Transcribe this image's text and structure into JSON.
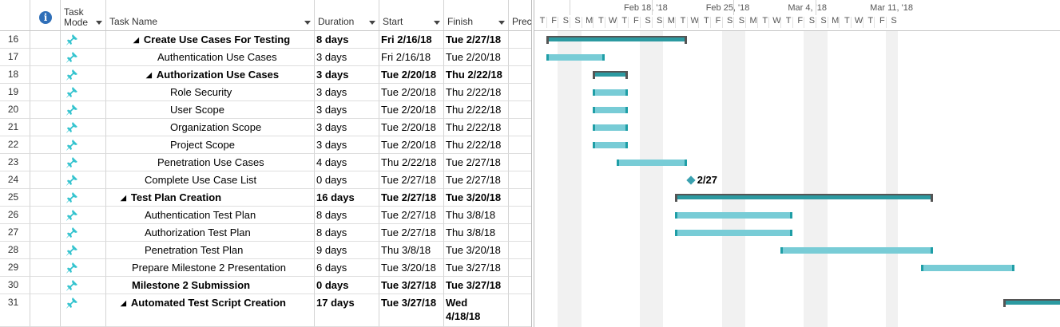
{
  "columns": {
    "info": "i",
    "mode": "Task Mode",
    "mode_line1": "Task",
    "mode_line2": "Mode",
    "name": "Task Name",
    "duration": "Duration",
    "start": "Start",
    "finish": "Finish",
    "pred": "Prec"
  },
  "timeline": {
    "weeks": [
      "Feb 18, '18",
      "Feb 25, '18",
      "Mar 4, '18",
      "Mar 11, '18"
    ],
    "days": [
      "T",
      "F",
      "S",
      "S",
      "M",
      "T",
      "W",
      "T",
      "F",
      "S",
      "S",
      "M",
      "T",
      "W",
      "T",
      "F",
      "S",
      "S",
      "M",
      "T",
      "W",
      "T",
      "F",
      "S",
      "S",
      "M",
      "T",
      "W",
      "T",
      "F",
      "S"
    ]
  },
  "tasks": [
    {
      "id": "16",
      "name": "Create Use Cases For Testing",
      "duration": "8 days",
      "start": "Fri 2/16/18",
      "finish": "Tue 2/27/18",
      "summary": true,
      "indent": 1
    },
    {
      "id": "17",
      "name": "Authentication Use Cases",
      "duration": "3 days",
      "start": "Fri 2/16/18",
      "finish": "Tue 2/20/18",
      "summary": false,
      "indent": 2
    },
    {
      "id": "18",
      "name": "Authorization Use Cases",
      "duration": "3 days",
      "start": "Tue 2/20/18",
      "finish": "Thu 2/22/18",
      "summary": true,
      "indent": 2
    },
    {
      "id": "19",
      "name": "Role Security",
      "duration": "3 days",
      "start": "Tue 2/20/18",
      "finish": "Thu 2/22/18",
      "summary": false,
      "indent": 3
    },
    {
      "id": "20",
      "name": "User Scope",
      "duration": "3 days",
      "start": "Tue 2/20/18",
      "finish": "Thu 2/22/18",
      "summary": false,
      "indent": 3
    },
    {
      "id": "21",
      "name": "Organization Scope",
      "duration": "3 days",
      "start": "Tue 2/20/18",
      "finish": "Thu 2/22/18",
      "summary": false,
      "indent": 3
    },
    {
      "id": "22",
      "name": "Project Scope",
      "duration": "3 days",
      "start": "Tue 2/20/18",
      "finish": "Thu 2/22/18",
      "summary": false,
      "indent": 3
    },
    {
      "id": "23",
      "name": "Penetration Use Cases",
      "duration": "4 days",
      "start": "Thu 2/22/18",
      "finish": "Tue 2/27/18",
      "summary": false,
      "indent": 2
    },
    {
      "id": "24",
      "name": "Complete Use Case List",
      "duration": "0 days",
      "start": "Tue 2/27/18",
      "finish": "Tue 2/27/18",
      "summary": false,
      "indent": 1
    },
    {
      "id": "25",
      "name": "Test Plan Creation",
      "duration": "16 days",
      "start": "Tue 2/27/18",
      "finish": "Tue 3/20/18",
      "summary": true,
      "indent": 0
    },
    {
      "id": "26",
      "name": "Authentication Test Plan",
      "duration": "8 days",
      "start": "Tue 2/27/18",
      "finish": "Thu 3/8/18",
      "summary": false,
      "indent": 1
    },
    {
      "id": "27",
      "name": "Authorization Test Plan",
      "duration": "8 days",
      "start": "Tue 2/27/18",
      "finish": "Thu 3/8/18",
      "summary": false,
      "indent": 1
    },
    {
      "id": "28",
      "name": "Penetration Test Plan",
      "duration": "9 days",
      "start": "Thu 3/8/18",
      "finish": "Tue 3/20/18",
      "summary": false,
      "indent": 1
    },
    {
      "id": "29",
      "name": "Prepare Milestone 2 Presentation",
      "duration": "6 days",
      "start": "Tue 3/20/18",
      "finish": "Tue 3/27/18",
      "summary": false,
      "indent": 0
    },
    {
      "id": "30",
      "name": "Milestone 2 Submission",
      "duration": "0 days",
      "start": "Tue 3/27/18",
      "finish": "Tue 3/27/18",
      "summary": false,
      "bold": true,
      "indent": 0
    },
    {
      "id": "31",
      "name": "Automated Test Script Creation",
      "duration": "17 days",
      "start": "Tue 3/27/18",
      "finish": "Wed 4/18/18",
      "finish_line1": "Wed",
      "finish_line2": "4/18/18",
      "summary": true,
      "indent": 0
    }
  ],
  "milestone_label": "2/27",
  "colors": {
    "bar": "#78ccd6",
    "bar_edge": "#1f9ea6",
    "summary": "#2c9aa1",
    "summary_cap": "#555555",
    "pin": "#36c4cf"
  }
}
